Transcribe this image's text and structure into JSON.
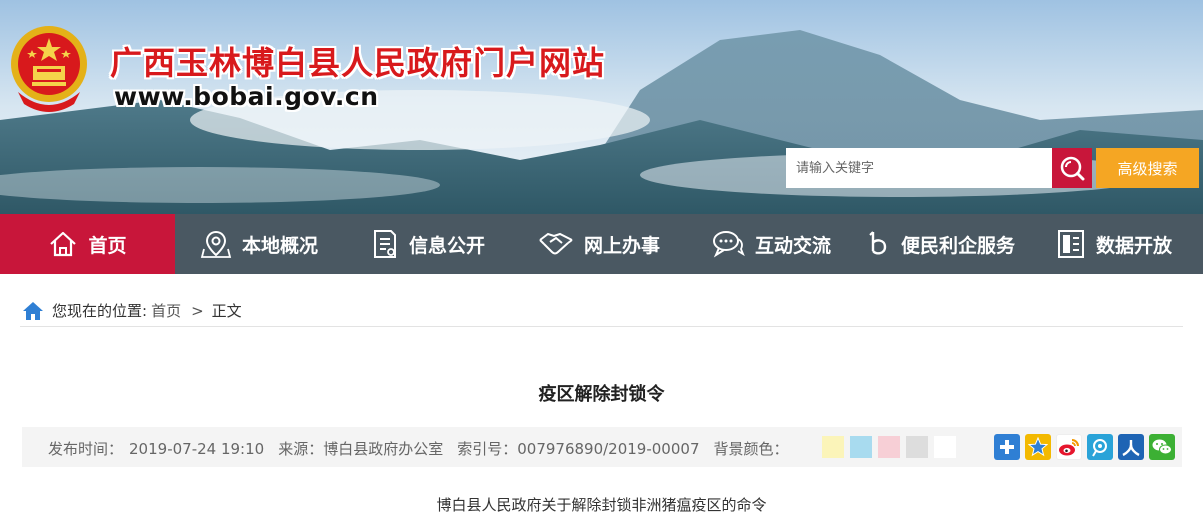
{
  "header": {
    "site_title": "广西玉林博白县人民政府门户网站",
    "site_url": "www.bobai.gov.cn",
    "search_placeholder": "请输入关键字",
    "advanced_search_label": "高级搜索"
  },
  "nav": {
    "items": [
      {
        "label": "首页",
        "icon": "home-icon"
      },
      {
        "label": "本地概况",
        "icon": "map-pin-icon"
      },
      {
        "label": "信息公开",
        "icon": "document-icon"
      },
      {
        "label": "网上办事",
        "icon": "handshake-icon"
      },
      {
        "label": "互动交流",
        "icon": "chat-icon"
      },
      {
        "label": "便民利企服务",
        "icon": "service-icon"
      },
      {
        "label": "数据开放",
        "icon": "data-icon"
      }
    ],
    "active_index": 0
  },
  "breadcrumb": {
    "prefix": "您现在的位置:",
    "home": "首页",
    "separator": ">",
    "current": "正文"
  },
  "article": {
    "title": "疫区解除封锁令",
    "publish_label": "发布时间：",
    "publish_time": "2019-07-24 19:10",
    "source_label": "来源：",
    "source": "博白县政府办公室",
    "index_label": "索引号：",
    "index_no": "007976890/2019-00007",
    "bg_color_label": "背景颜色：",
    "subtitle": "博白县人民政府关于解除封锁非洲猪瘟疫区的命令"
  },
  "bg_swatches": [
    "#fbf4b9",
    "#a8dbef",
    "#f7cfd6",
    "#dddddd",
    "#ffffff"
  ],
  "share_icons": [
    {
      "name": "share-more-icon",
      "color": "#2f7fd4"
    },
    {
      "name": "qzone-icon",
      "color": "#f3b900"
    },
    {
      "name": "weibo-icon",
      "color": "#e6162d"
    },
    {
      "name": "tencent-weibo-icon",
      "color": "#2aa3d8"
    },
    {
      "name": "renren-icon",
      "color": "#1e64b4"
    },
    {
      "name": "wechat-icon",
      "color": "#3cb034"
    }
  ],
  "colors": {
    "brand_red": "#c8163a",
    "nav_bg": "#4a5862",
    "adv_search_bg": "#f5a623",
    "title_red": "#d8191c"
  }
}
